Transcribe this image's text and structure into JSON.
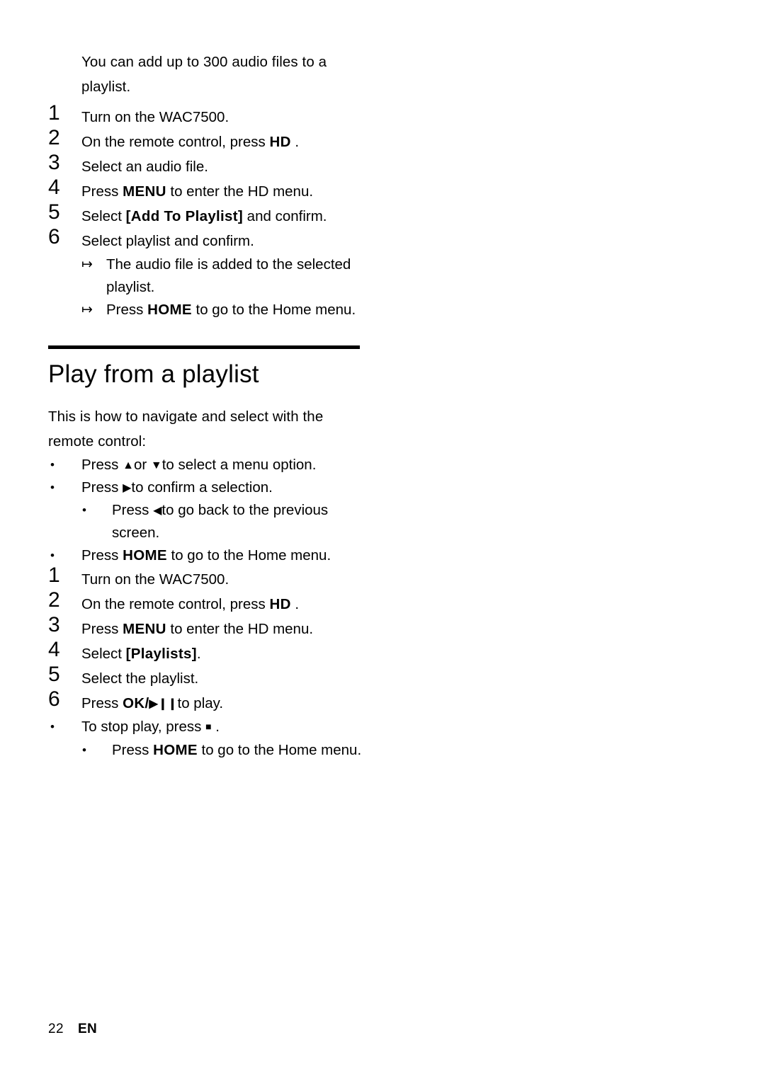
{
  "page": {
    "number": "22",
    "language": "EN"
  },
  "intro": {
    "text": "You can add up to 300 audio files to a playlist."
  },
  "add_steps": [
    {
      "num": "1",
      "pre": "Turn on the WAC7500.",
      "bold": "",
      "post": ""
    },
    {
      "num": "2",
      "pre": "On the remote control, press ",
      "bold": "HD",
      "post": " ."
    },
    {
      "num": "3",
      "pre": "Select an audio file.",
      "bold": "",
      "post": ""
    },
    {
      "num": "4",
      "pre": "Press ",
      "bold": "MENU",
      "post": " to enter the HD menu."
    },
    {
      "num": "5",
      "pre": "Select ",
      "bold": "[Add To Playlist]",
      "post": " and confirm."
    },
    {
      "num": "6",
      "pre": "Select playlist and confirm.",
      "bold": "",
      "post": ""
    }
  ],
  "add_results": [
    {
      "arrow": "↦",
      "pre": "The audio file is added to the selected playlist.",
      "bold": "",
      "post": ""
    },
    {
      "arrow": "↦",
      "pre": "Press ",
      "bold": "HOME",
      "post": " to go to the Home menu."
    }
  ],
  "section": {
    "title": "Play from a playlist",
    "intro": "This is how to navigate and select with the remote control:"
  },
  "nav_bullets": [
    {
      "dot": "•",
      "pre": "Press ",
      "sym1": "▲",
      "mid": "or ",
      "sym2": "▼",
      "post": "to select a menu option."
    },
    {
      "dot": "•",
      "pre": "Press ",
      "sym1": "▶",
      "mid": "",
      "sym2": "",
      "post": "to confirm a selection."
    },
    {
      "dot": "•",
      "pre": "Press ",
      "sym1": "◀",
      "mid": "",
      "sym2": "",
      "post": "to go back to the previous screen."
    },
    {
      "dot": "•",
      "pre": "Press ",
      "bold": "HOME",
      "post": " to go to the Home menu."
    }
  ],
  "play_steps": [
    {
      "num": "1",
      "pre": "Turn on the WAC7500.",
      "bold": "",
      "post": ""
    },
    {
      "num": "2",
      "pre": "On the remote control, press ",
      "bold": "HD",
      "post": " ."
    },
    {
      "num": "3",
      "pre": "Press ",
      "bold": "MENU",
      "post": "  to enter the HD menu."
    },
    {
      "num": "4",
      "pre": "Select ",
      "bold": "[Playlists]",
      "post": "."
    },
    {
      "num": "5",
      "pre": "Select the playlist.",
      "bold": "",
      "post": ""
    },
    {
      "num": "6",
      "pre": "Press ",
      "bold": "OK/",
      "sym": "▶❙❙",
      "post": "to play."
    }
  ],
  "play_bullets": [
    {
      "dot": "•",
      "pre": "To stop play, press ",
      "sym": "■",
      "post": " ."
    },
    {
      "dot": "•",
      "pre": "Press ",
      "bold": "HOME",
      "post": " to go to the Home menu."
    }
  ]
}
